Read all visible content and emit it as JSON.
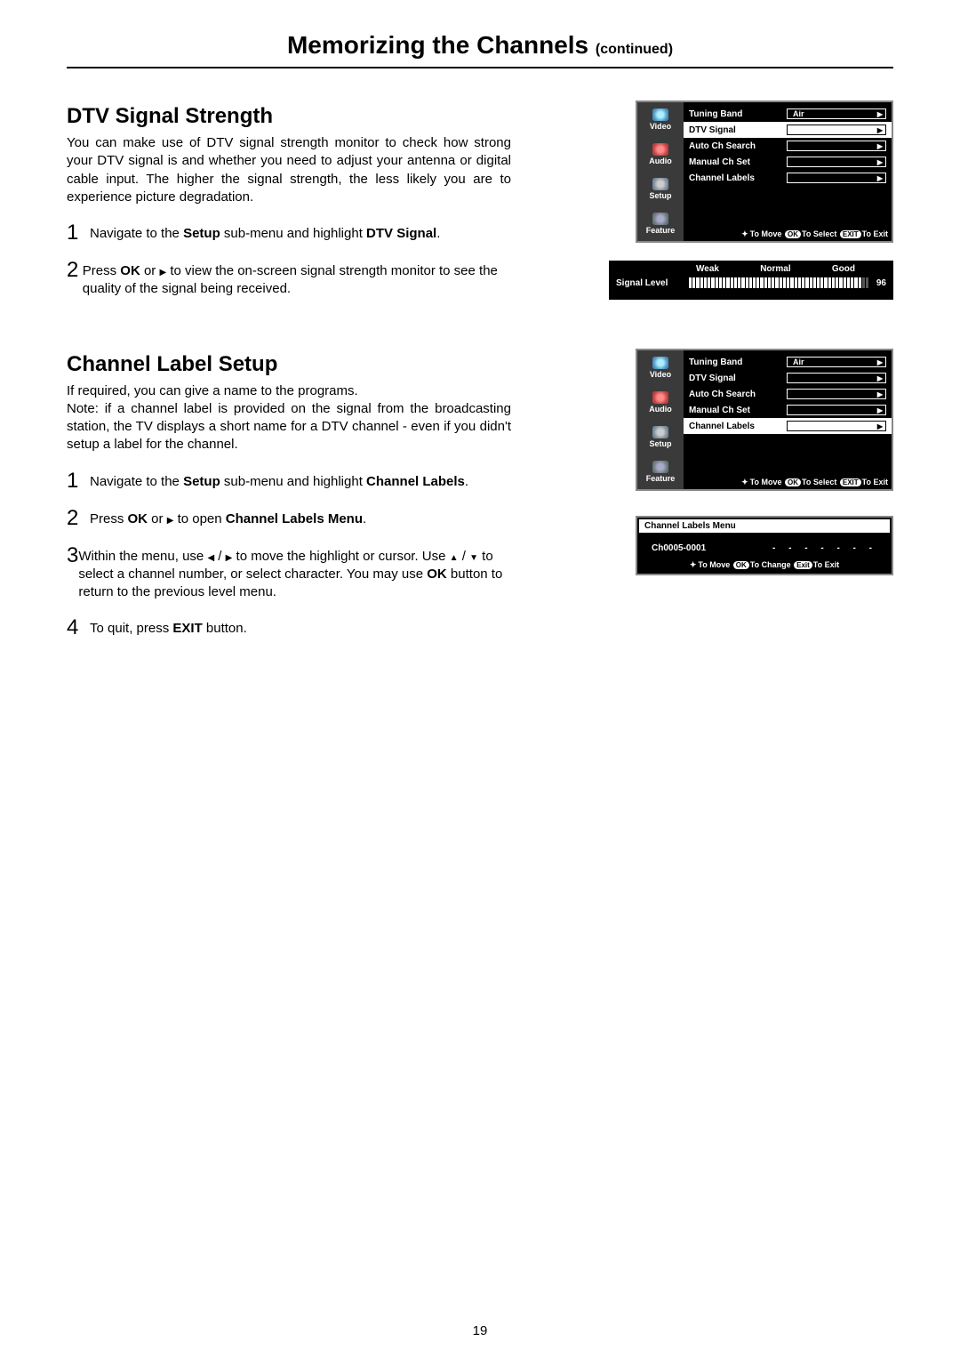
{
  "page_title": "Memorizing the Channels",
  "page_title_suffix": "(continued)",
  "page_number": "19",
  "dtv": {
    "heading": "DTV Signal Strength",
    "intro": "You can make use of DTV signal strength monitor to check how strong your DTV signal is and whether you need to adjust your antenna or digital cable input. The higher the signal strength, the less likely you are to experience picture degradation.",
    "step1_a": "Navigate to the ",
    "step1_b": "Setup",
    "step1_c": " sub-menu and highlight ",
    "step1_d": "DTV Signal",
    "step1_e": ".",
    "step2_a": "Press ",
    "step2_b": "OK",
    "step2_c": "  or  ",
    "step2_d": " to view the on-screen signal strength monitor to see the quality of the signal being received."
  },
  "channel": {
    "heading": "Channel  Label  Setup",
    "intro1": "If required,  you can give a name to the programs.",
    "note_label": "Note",
    "intro2": ": if a channel label is provided on the signal from the broadcasting station,  the TV displays a short name for a DTV channel - even if you didn't setup a label for the channel.",
    "step1_a": "Navigate to the ",
    "step1_b": "Setup",
    "step1_c": " sub-menu and highlight ",
    "step1_d": "Channel  Labels",
    "step1_e": ".",
    "step2_a": "Press ",
    "step2_b": "OK",
    "step2_c": "  or  ",
    "step2_d": " to open ",
    "step2_e": "Channel Labels Menu",
    "step2_f": ".",
    "step3_a": "Within the menu, use  ",
    "step3_b": " /  ",
    "step3_c": " to move the highlight or cursor. Use  ",
    "step3_d": " / ",
    "step3_e": "  to select a channel number, or select character. You may use  ",
    "step3_f": "OK",
    "step3_g": " button to return to the previous level menu.",
    "step4_a": "To quit,  press ",
    "step4_b": "EXIT",
    "step4_c": " button."
  },
  "osd": {
    "sidebar": [
      "Video",
      "Audio",
      "Setup",
      "Feature"
    ],
    "items": [
      "Tuning Band",
      "DTV Signal",
      "Auto Ch Search",
      "Manual Ch Set",
      "Channel Labels"
    ],
    "tuning_value": "Air",
    "footer_move": "To Move",
    "footer_ok": "OK",
    "footer_select": "To Select",
    "footer_exit": "EXIT",
    "footer_toexit": "To Exit"
  },
  "signal": {
    "weak": "Weak",
    "normal": "Normal",
    "good": "Good",
    "label": "Signal  Level",
    "value": "96"
  },
  "ch_menu": {
    "title": "Channel Labels Menu",
    "channel": "Ch0005-0001",
    "dashes": "- - - - - - -",
    "footer_move": "To Move",
    "footer_ok": "OK",
    "footer_change": "To Change",
    "footer_exit": "Exit",
    "footer_toexit": "To Exit"
  }
}
